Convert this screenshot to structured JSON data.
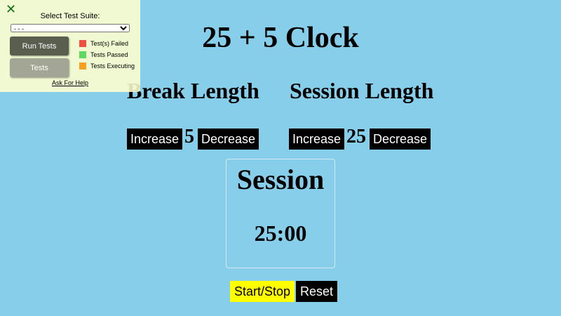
{
  "app": {
    "title": "25 + 5 Clock"
  },
  "break": {
    "label": "Break Length",
    "increase_label": "Increase",
    "value": "5",
    "decrease_label": "Decrease"
  },
  "session": {
    "label": "Session Length",
    "increase_label": "Increase",
    "value": "25",
    "decrease_label": "Decrease"
  },
  "timer": {
    "label": "Session",
    "time_left": "25:00"
  },
  "controls": {
    "start_stop_label": "Start/Stop",
    "reset_label": "Reset"
  },
  "test_panel": {
    "close_icon": "close-icon",
    "title": "Select Test Suite:",
    "select_value": "- - -",
    "run_tests_label": "Run Tests",
    "tests_label": "Tests",
    "legend": [
      {
        "label": "Test(s) Failed",
        "color": "#f05040"
      },
      {
        "label": "Tests Passed",
        "color": "#5ed85e"
      },
      {
        "label": "Tests Executing",
        "color": "#f5a020"
      }
    ],
    "help_link": "Ask For Help"
  },
  "colors": {
    "background": "#87ceeb",
    "button_dark": "#000000",
    "start_stop": "#ffff00",
    "panel_background": "#ffffcd"
  }
}
